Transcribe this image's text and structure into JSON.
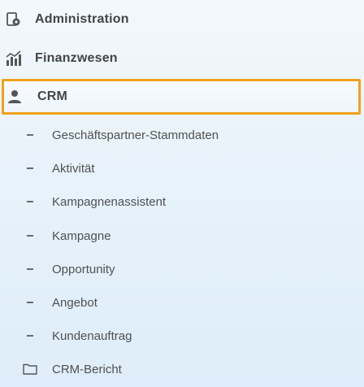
{
  "nav": {
    "top_items": [
      {
        "label": "Administration",
        "icon": "admin-icon"
      },
      {
        "label": "Finanzwesen",
        "icon": "finance-chart-icon"
      },
      {
        "label": "CRM",
        "icon": "user-icon",
        "highlighted": true
      }
    ],
    "crm_children": [
      {
        "label": "Geschäftspartner-Stammdaten"
      },
      {
        "label": "Aktivität"
      },
      {
        "label": "Kampagnenassistent"
      },
      {
        "label": "Kampagne"
      },
      {
        "label": "Opportunity"
      },
      {
        "label": "Angebot"
      },
      {
        "label": "Kundenauftrag"
      }
    ],
    "crm_folder": {
      "label": "CRM-Bericht",
      "icon": "folder-icon"
    }
  },
  "colors": {
    "highlight_border": "#f0a11c",
    "text": "#4a4a4a"
  }
}
